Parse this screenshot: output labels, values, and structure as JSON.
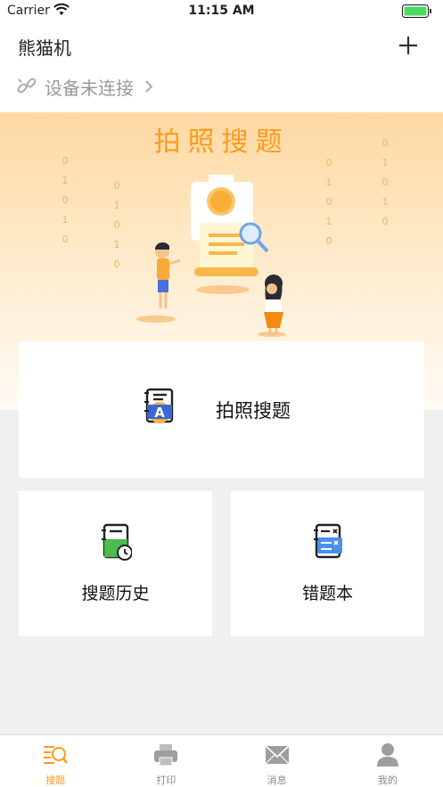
{
  "status_bar": {
    "carrier": "Carrier",
    "time": "11:15 AM"
  },
  "header": {
    "title": "熊猫机",
    "add_icon": "plus-icon"
  },
  "device": {
    "status": "设备未连接",
    "icon": "unlink-icon"
  },
  "hero": {
    "title": "拍照搜题",
    "binary_columns": [
      [
        "0",
        "1",
        "0",
        "1",
        "0"
      ],
      [
        "0",
        "1",
        "0",
        "1",
        "0"
      ],
      [
        "0",
        "1",
        "0",
        "1",
        "0"
      ],
      [
        "0",
        "1",
        "0",
        "1",
        "0"
      ]
    ]
  },
  "cards": {
    "main": {
      "label": "拍照搜题",
      "icon": "book-a-icon"
    },
    "history": {
      "label": "搜题历史",
      "icon": "history-book-icon"
    },
    "errors": {
      "label": "错题本",
      "icon": "error-notebook-icon"
    }
  },
  "tabs": [
    {
      "label": "搜题",
      "icon": "search-doc-icon",
      "active": true
    },
    {
      "label": "打印",
      "icon": "printer-icon",
      "active": false
    },
    {
      "label": "消息",
      "icon": "mail-icon",
      "active": false
    },
    {
      "label": "我的",
      "icon": "user-icon",
      "active": false
    }
  ],
  "colors": {
    "accent": "#ff9a1c",
    "background": "#f0f0f0",
    "hero_top": "#fdd9a3"
  }
}
